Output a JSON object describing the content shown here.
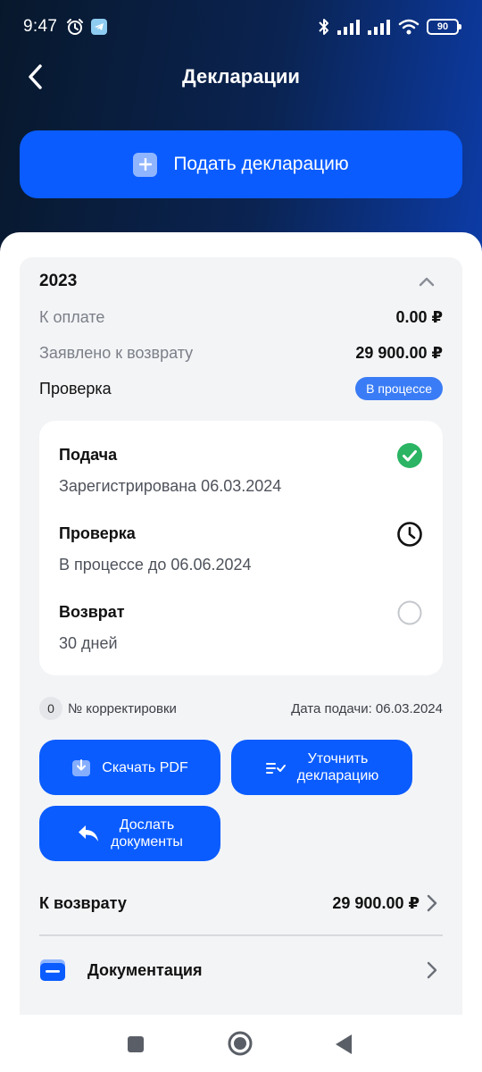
{
  "status_bar": {
    "time": "9:47",
    "battery": "90"
  },
  "header": {
    "title": "Декларации",
    "submit_label": "Подать декларацию"
  },
  "declaration": {
    "year": "2023",
    "to_pay_label": "К оплате",
    "to_pay_value": "0.00 ₽",
    "claimed_label": "Заявлено к возврату",
    "claimed_value": "29 900.00 ₽",
    "check_label": "Проверка",
    "check_status": "В процессе",
    "steps": [
      {
        "title": "Подача",
        "subtitle": "Зарегистрирована 06.03.2024",
        "state": "done",
        "icon": "check-circle-icon"
      },
      {
        "title": "Проверка",
        "subtitle": "В процессе до 06.06.2024",
        "state": "in-progress",
        "icon": "clock-icon"
      },
      {
        "title": "Возврат",
        "subtitle": "30 дней",
        "state": "pending",
        "icon": "empty-circle-icon"
      }
    ],
    "correction_count": "0",
    "correction_label": "№ корректировки",
    "submission_date": "Дата подачи: 06.03.2024",
    "actions": {
      "download_pdf": "Скачать PDF",
      "clarify_line1": "Уточнить",
      "clarify_line2": "декларацию",
      "send_docs_line1": "Дослать",
      "send_docs_line2": "документы"
    },
    "refund_label": "К возврату",
    "refund_value": "29 900.00 ₽",
    "docs_label": "Документация"
  },
  "colors": {
    "accent": "#0a5cff",
    "badge": "#3a7cf5",
    "success": "#2ab463",
    "header_dark": "#08182c",
    "header_blue": "#0c3ca8"
  }
}
